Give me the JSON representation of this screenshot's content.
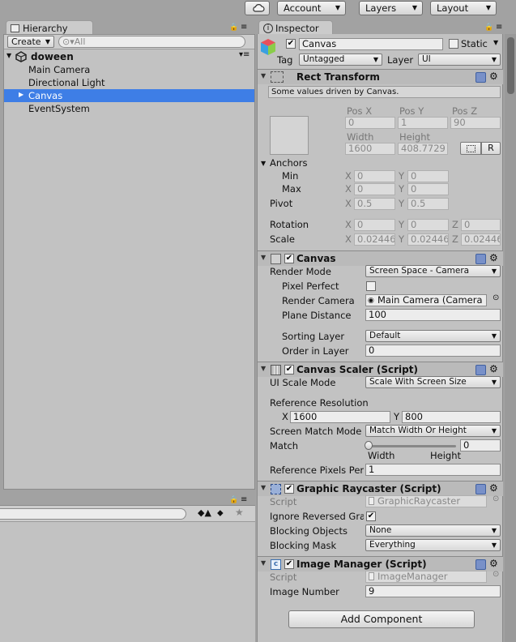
{
  "toolbar": {
    "cloud_icon": "cloud-icon",
    "account_label": "Account",
    "layers_label": "Layers",
    "layout_label": "Layout"
  },
  "hierarchy": {
    "tab_label": "Hierarchy",
    "create_label": "Create",
    "search_placeholder": "All",
    "scene_name": "doween",
    "items": [
      {
        "label": "Main Camera"
      },
      {
        "label": "Directional Light"
      },
      {
        "label": "Canvas",
        "selected": true
      },
      {
        "label": "EventSystem"
      }
    ]
  },
  "inspector": {
    "tab_label": "Inspector",
    "object_name": "Canvas",
    "static_label": "Static",
    "tag_label": "Tag",
    "tag_value": "Untagged",
    "layer_label": "Layer",
    "layer_value": "UI",
    "rect_transform": {
      "title": "Rect Transform",
      "note": "Some values driven by Canvas.",
      "pos_x_label": "Pos X",
      "pos_y_label": "Pos Y",
      "pos_z_label": "Pos Z",
      "pos_x": "0",
      "pos_y": "1",
      "pos_z": "90",
      "width_label": "Width",
      "height_label": "Height",
      "width": "1600",
      "height": "408.7729",
      "r_label": "R",
      "anchors_label": "Anchors",
      "min_label": "Min",
      "max_label": "Max",
      "x_label": "X",
      "y_label": "Y",
      "z_label": "Z",
      "min_x": "0",
      "min_y": "0",
      "max_x": "0",
      "max_y": "0",
      "pivot_label": "Pivot",
      "pivot_x": "0.5",
      "pivot_y": "0.5",
      "rotation_label": "Rotation",
      "rot_x": "0",
      "rot_y": "0",
      "rot_z": "0",
      "scale_label": "Scale",
      "scale_x": "0.02446",
      "scale_y": "0.02446",
      "scale_z": "0.02446"
    },
    "canvas": {
      "title": "Canvas",
      "render_mode_label": "Render Mode",
      "render_mode": "Screen Space - Camera",
      "pixel_perfect_label": "Pixel Perfect",
      "render_camera_label": "Render Camera",
      "render_camera": "Main Camera (Camera",
      "plane_distance_label": "Plane Distance",
      "plane_distance": "100",
      "sorting_layer_label": "Sorting Layer",
      "sorting_layer": "Default",
      "order_label": "Order in Layer",
      "order": "0"
    },
    "canvas_scaler": {
      "title": "Canvas Scaler (Script)",
      "ui_scale_label": "UI Scale Mode",
      "ui_scale": "Scale With Screen Size",
      "ref_res_label": "Reference Resolution",
      "ref_x_label": "X",
      "ref_x": "1600",
      "ref_y_label": "Y",
      "ref_y": "800",
      "match_mode_label": "Screen Match Mode",
      "match_mode": "Match Width Or Height",
      "match_label": "Match",
      "match_value": "0",
      "width_label": "Width",
      "height_label": "Height",
      "ref_ppu_label": "Reference Pixels Per",
      "ref_ppu": "1"
    },
    "graphic_raycaster": {
      "title": "Graphic Raycaster (Script)",
      "script_label": "Script",
      "script": "GraphicRaycaster",
      "ignore_label": "Ignore Reversed Gra",
      "blocking_objects_label": "Blocking Objects",
      "blocking_objects": "None",
      "blocking_mask_label": "Blocking Mask",
      "blocking_mask": "Everything"
    },
    "image_manager": {
      "title": "Image Manager (Script)",
      "script_label": "Script",
      "script": "ImageManager",
      "image_number_label": "Image Number",
      "image_number": "9"
    },
    "add_component_label": "Add Component"
  }
}
